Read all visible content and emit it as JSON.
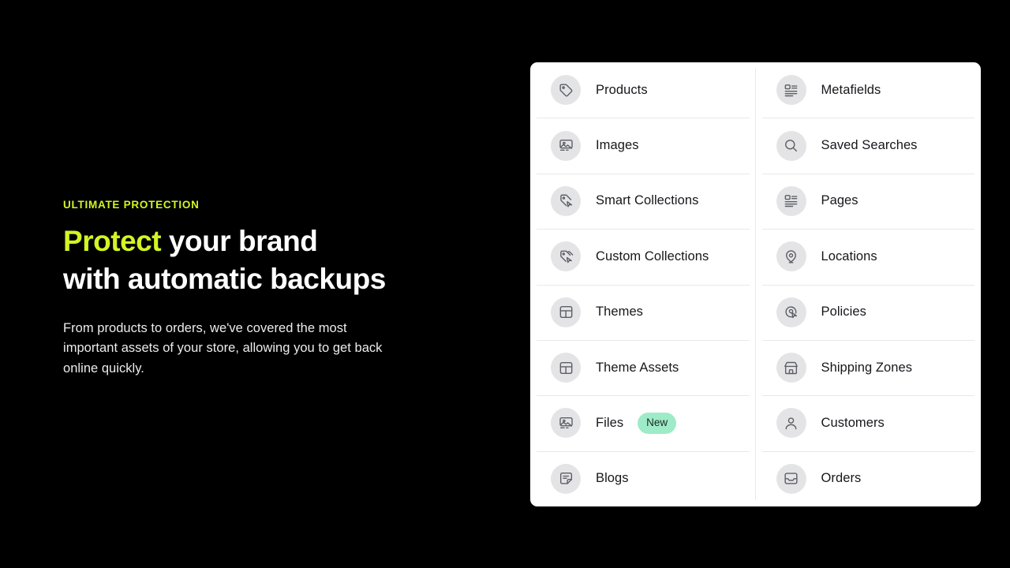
{
  "hero": {
    "eyebrow": "ULTIMATE PROTECTION",
    "headline_highlight": "Protect",
    "headline_rest": " your brand",
    "headline_line2": "with automatic backups",
    "body": "From products to orders, we've covered the most important assets of your store, allowing you to get back online quickly.",
    "accent_color": "#d4f423",
    "text_color": "#ffffff",
    "background_color": "#000000"
  },
  "card": {
    "background_color": "#ffffff",
    "divider_color": "#e9e9ea",
    "icon_circle_color": "#e4e4e6",
    "badge_color": "#9eebc8",
    "left_column": [
      {
        "label": "Products",
        "icon": "tag-icon"
      },
      {
        "label": "Images",
        "icon": "image-icon"
      },
      {
        "label": "Smart Collections",
        "icon": "tag-cursor-icon"
      },
      {
        "label": "Custom Collections",
        "icon": "tags-cursor-icon"
      },
      {
        "label": "Themes",
        "icon": "layout-icon"
      },
      {
        "label": "Theme Assets",
        "icon": "layout-icon"
      },
      {
        "label": "Files",
        "icon": "image-icon",
        "badge": "New"
      },
      {
        "label": "Blogs",
        "icon": "note-icon"
      }
    ],
    "right_column": [
      {
        "label": "Metafields",
        "icon": "text-block-icon"
      },
      {
        "label": "Saved Searches",
        "icon": "search-icon"
      },
      {
        "label": "Pages",
        "icon": "text-block-icon"
      },
      {
        "label": "Locations",
        "icon": "map-pin-icon"
      },
      {
        "label": "Policies",
        "icon": "target-cursor-icon"
      },
      {
        "label": "Shipping Zones",
        "icon": "store-icon"
      },
      {
        "label": "Customers",
        "icon": "person-icon"
      },
      {
        "label": "Orders",
        "icon": "inbox-icon"
      }
    ]
  }
}
